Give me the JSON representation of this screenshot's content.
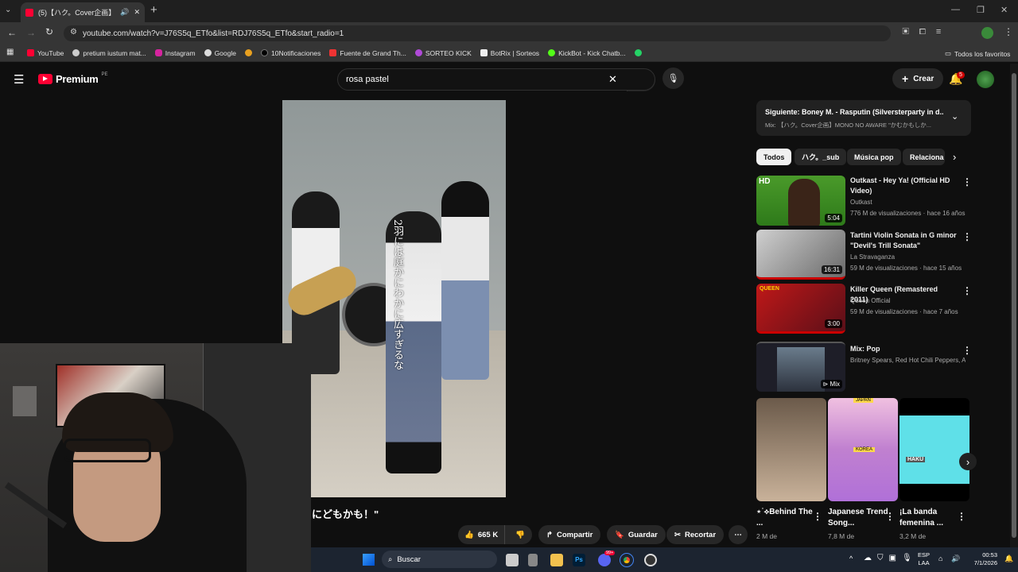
{
  "browser": {
    "tab_title": "(5)【ハク。Cover企画】MONO",
    "url": "youtube.com/watch?v=J76S5q_ETfo&list=RDJ76S5q_ETfo&start_radio=1",
    "bookmarks": [
      "YouTube",
      "pretium iustum mat...",
      "Instagram",
      "Google",
      "10Notificaciones",
      "Fuente de Grand Th...",
      "SORTEO KICK",
      "BotRix | Sorteos",
      "KickBot - Kick Chatb..."
    ],
    "all_bookmarks": "Todos los favoritos"
  },
  "header": {
    "logo": "Premium",
    "region": "PE",
    "search_value": "rosa pastel",
    "create_label": "Crear",
    "notif_count": "5"
  },
  "video": {
    "vertical_caption": "2羽には庭かにわかに広すぎるな",
    "subtitle": "にどもかも！\"",
    "like_count": "665 K",
    "share": "Compartir",
    "save": "Guardar",
    "clip": "Recortar"
  },
  "playlist": {
    "next": "Siguiente: Boney M. - Rasputin (Silversterparty in d...",
    "mix": "Mix: 【ハク。Cover企画】MONO NO AWARE \"かむかもしか..."
  },
  "chips": [
    "Todos",
    "ハク。_sub",
    "Música pop",
    "Relaciona"
  ],
  "videos": [
    {
      "title": "Outkast - Hey Ya! (Official HD Video)",
      "channel": "Outkast",
      "meta": "776 M de visualizaciones · hace 16 años",
      "duration": "5:04",
      "badge": "HD"
    },
    {
      "title": "Tartini Violin Sonata in G minor \"Devil's Trill Sonata\"",
      "channel": "La Stravaganza",
      "meta": "59 M de visualizaciones · hace 15 años",
      "duration": "16:31"
    },
    {
      "title": "Killer Queen (Remastered 2011)",
      "channel": "Queen Official",
      "meta": "59 M de visualizaciones · hace 7 años",
      "duration": "3:00"
    },
    {
      "title": "Mix: Pop",
      "channel": "Britney Spears, Red Hot Chili Peppers, Al...",
      "meta": "",
      "duration": "Mix"
    }
  ],
  "shorts": [
    {
      "title": "⋆˙⟡Behind The ...",
      "views": "2 M de"
    },
    {
      "title": "Japanese Trend Song...",
      "views": "7,8 M de"
    },
    {
      "title": "¡La banda femenina ...",
      "views": "3,2 M de"
    }
  ],
  "shorts_labels": {
    "japan": "JAPAN",
    "korea": "KOREA",
    "haku": "HAKU"
  },
  "taskbar": {
    "search": "Buscar",
    "lang1": "ESP",
    "lang2": "LAA",
    "time": "00:53",
    "date": "7/1/2026",
    "discord_badge": "99+"
  },
  "colors": {
    "yt_red": "#ff0033",
    "bg": "#0f0f0f",
    "taskbar": "#1c2430"
  }
}
